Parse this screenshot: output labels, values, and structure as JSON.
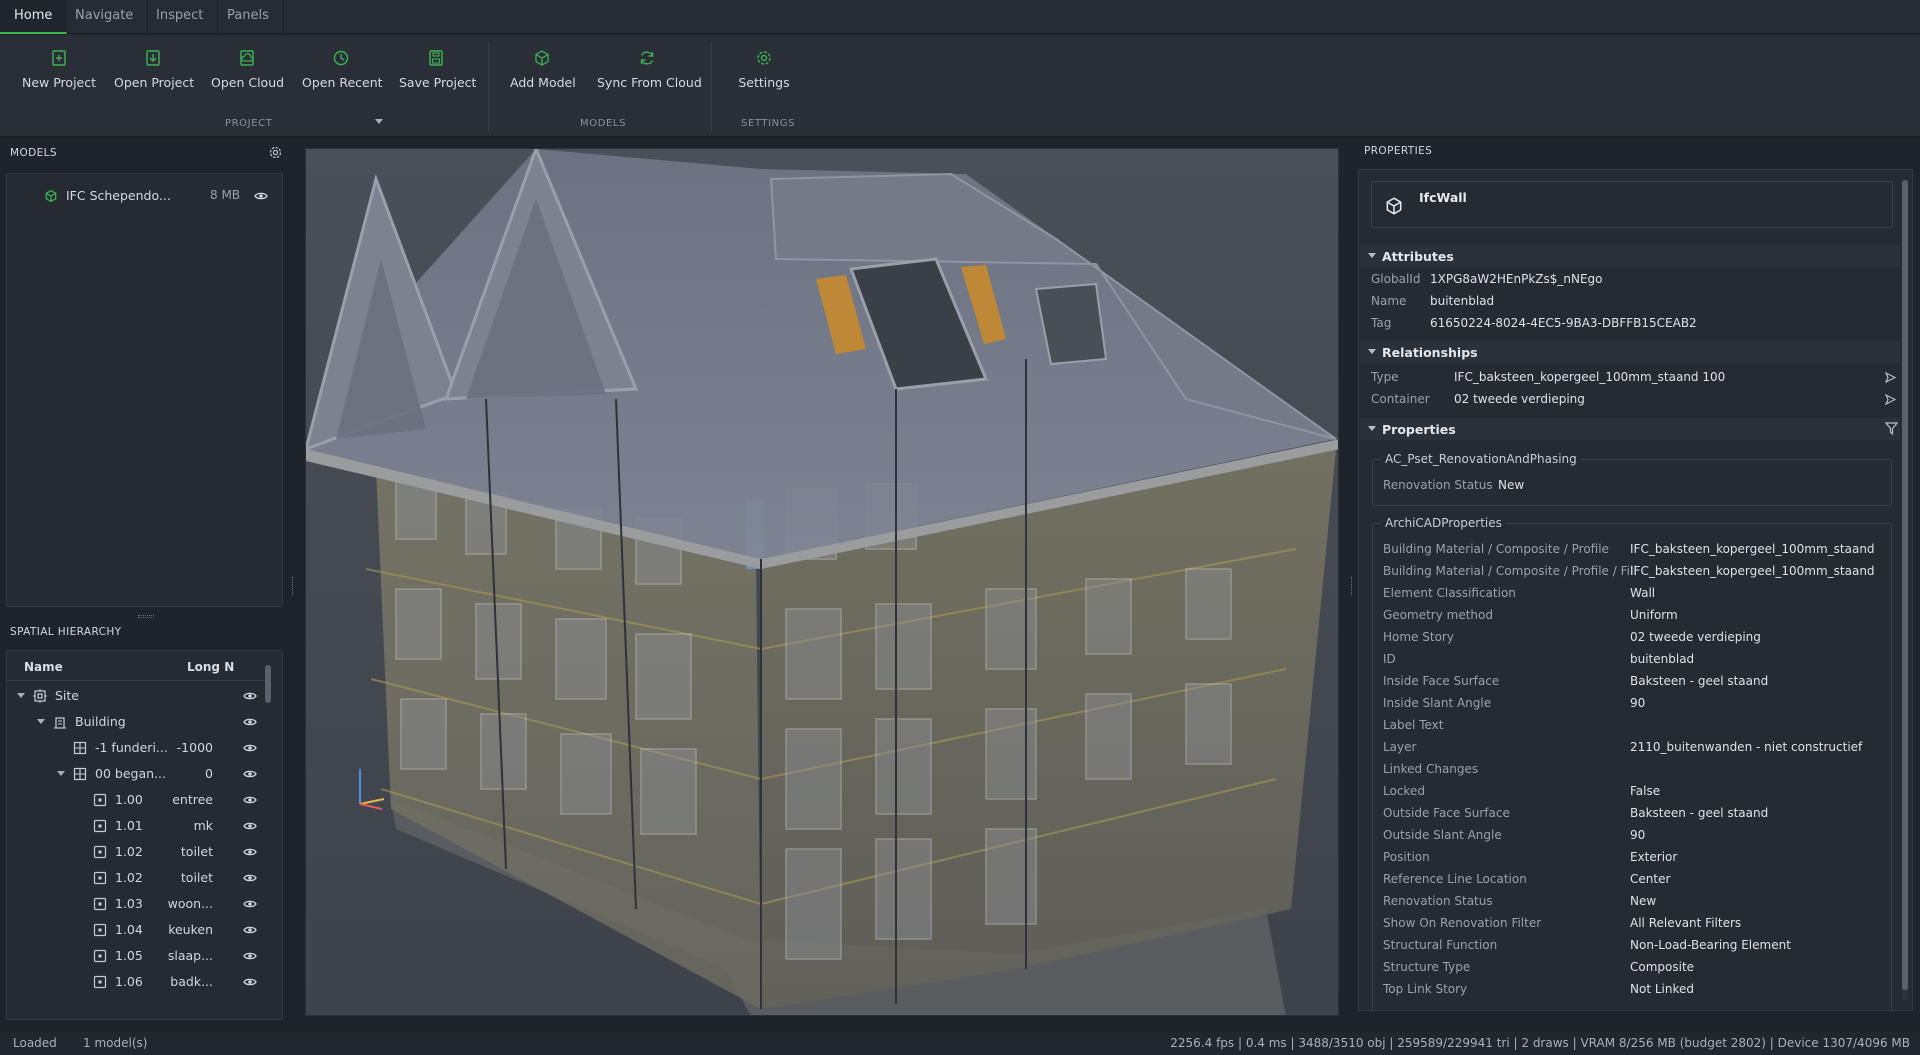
{
  "tabs": [
    "Home",
    "Navigate",
    "Inspect",
    "Panels"
  ],
  "ribbon": {
    "buttons": [
      "New Project",
      "Open Project",
      "Open Cloud",
      "Open Recent",
      "Save Project",
      "Add Model",
      "Sync From Cloud",
      "Settings"
    ],
    "groups": [
      "PROJECT",
      "MODELS",
      "SETTINGS"
    ],
    "icons": [
      "new-file-icon",
      "open-file-icon",
      "cloud-icon",
      "recent-icon",
      "save-icon",
      "cube-icon",
      "sync-icon",
      "gear-icon"
    ],
    "accent": "#3cb453"
  },
  "models_panel": {
    "title": "MODELS",
    "items": [
      {
        "name": "IFC Schependo...",
        "size": "8 MB"
      }
    ]
  },
  "hierarchy": {
    "title": "SPATIAL HIERARCHY",
    "columns": [
      "Name",
      "Long N"
    ],
    "rows": [
      {
        "name": "Site",
        "long": "",
        "level": 0,
        "expanded": true,
        "icon": "site-icon"
      },
      {
        "name": "Building",
        "long": "",
        "level": 1,
        "expanded": true,
        "icon": "building-icon"
      },
      {
        "name": "-1 funderi...",
        "long": "-1000",
        "level": 2,
        "expanded": false,
        "icon": "storey-icon"
      },
      {
        "name": "00 began...",
        "long": "0",
        "level": 2,
        "expanded": true,
        "icon": "storey-icon"
      },
      {
        "name": "1.00",
        "long": "entree",
        "level": 3,
        "icon": "space-icon"
      },
      {
        "name": "1.01",
        "long": "mk",
        "level": 3,
        "icon": "space-icon"
      },
      {
        "name": "1.02",
        "long": "toilet",
        "level": 3,
        "icon": "space-icon"
      },
      {
        "name": "1.02",
        "long": "toilet",
        "level": 3,
        "icon": "space-icon"
      },
      {
        "name": "1.03",
        "long": "woon...",
        "level": 3,
        "icon": "space-icon"
      },
      {
        "name": "1.04",
        "long": "keuken",
        "level": 3,
        "icon": "space-icon"
      },
      {
        "name": "1.05",
        "long": "slaap...",
        "level": 3,
        "icon": "space-icon"
      },
      {
        "name": "1.06",
        "long": "badk...",
        "level": 3,
        "icon": "space-icon"
      }
    ]
  },
  "properties": {
    "title": "PROPERTIES",
    "entity": "IfcWall",
    "sections": {
      "attributes": "Attributes",
      "relationships": "Relationships",
      "properties": "Properties"
    },
    "attributes": [
      {
        "k": "GlobalId",
        "v": "1XPG8aW2HEnPkZs$_nNEgo"
      },
      {
        "k": "Name",
        "v": "buitenblad"
      },
      {
        "k": "Tag",
        "v": "61650224-8024-4EC5-9BA3-DBFFB15CEAB2"
      }
    ],
    "relationships": [
      {
        "k": "Type",
        "v": "IFC_baksteen_kopergeel_100mm_staand 100"
      },
      {
        "k": "Container",
        "v": "02 tweede verdieping"
      }
    ],
    "pset1": {
      "title": "AC_Pset_RenovationAndPhasing",
      "rows": [
        {
          "k": "Renovation Status",
          "v": "New"
        }
      ]
    },
    "pset2": {
      "title": "ArchiCADProperties",
      "rows": [
        {
          "k": "Building Material / Composite / Profile",
          "v": "IFC_baksteen_kopergeel_100mm_staand"
        },
        {
          "k": "Building Material / Composite / Profile / Fill",
          "v": "IFC_baksteen_kopergeel_100mm_staand"
        },
        {
          "k": "Element Classification",
          "v": "Wall"
        },
        {
          "k": "Geometry method",
          "v": "Uniform"
        },
        {
          "k": "Home Story",
          "v": "02 tweede verdieping"
        },
        {
          "k": "ID",
          "v": "buitenblad"
        },
        {
          "k": "Inside Face Surface",
          "v": "Baksteen - geel staand"
        },
        {
          "k": "Inside Slant Angle",
          "v": "90"
        },
        {
          "k": "Label Text",
          "v": ""
        },
        {
          "k": "Layer",
          "v": "2110_buitenwanden - niet constructief"
        },
        {
          "k": "Linked Changes",
          "v": ""
        },
        {
          "k": "Locked",
          "v": "False"
        },
        {
          "k": "Outside Face Surface",
          "v": "Baksteen - geel staand"
        },
        {
          "k": "Outside Slant Angle",
          "v": "90"
        },
        {
          "k": "Position",
          "v": "Exterior"
        },
        {
          "k": "Reference Line Location",
          "v": "Center"
        },
        {
          "k": "Renovation Status",
          "v": "New"
        },
        {
          "k": "Show On Renovation Filter",
          "v": "All Relevant Filters"
        },
        {
          "k": "Structural Function",
          "v": "Non-Load-Bearing Element"
        },
        {
          "k": "Structure Type",
          "v": "Composite"
        },
        {
          "k": "Top Link Story",
          "v": "Not Linked"
        }
      ]
    }
  },
  "status": {
    "state": "Loaded",
    "models": "1 model(s)",
    "perf": "2256.4 fps | 0.4 ms | 3488/3510 obj | 259589/229941 tri | 2 draws | VRAM 8/256 MB (budget 2802) | Device 1307/4096 MB"
  }
}
